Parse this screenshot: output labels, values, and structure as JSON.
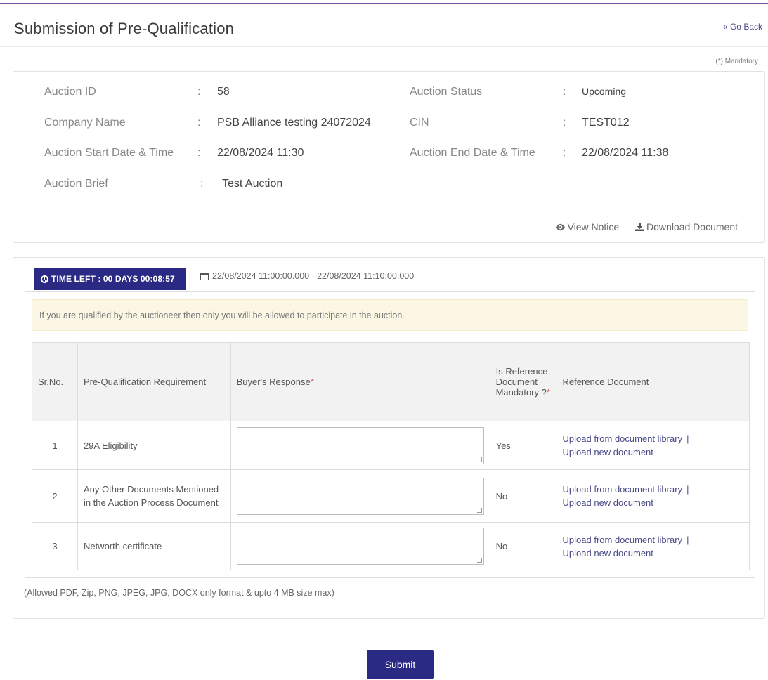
{
  "header": {
    "title": "Submission of Pre-Qualification",
    "go_back": "« Go Back",
    "mandatory_note": "(*) Mandatory"
  },
  "auction": {
    "fields": [
      {
        "label": "Auction ID",
        "value": "58"
      },
      {
        "label": "Auction Status",
        "value": "Upcoming"
      },
      {
        "label": "Company Name",
        "value": "PSB Alliance testing 24072024"
      },
      {
        "label": "CIN",
        "value": "TEST012"
      },
      {
        "label": "Auction Start Date & Time",
        "value": "22/08/2024 11:30"
      },
      {
        "label": "Auction End Date & Time",
        "value": "22/08/2024 11:38"
      },
      {
        "label": "Auction Brief",
        "value": "Test Auction"
      }
    ],
    "colon": ":",
    "view_notice": "View Notice",
    "separator": "|",
    "download_document": "Download Document"
  },
  "prequal": {
    "time_left": "TIME LEFT : 00 DAYS 00:08:57",
    "start_datetime": "22/08/2024 11:00:00.000",
    "end_datetime": "22/08/2024 11:10:00.000",
    "alert": "If you are qualified by the auctioneer then only you will be allowed to participate in the auction.",
    "columns": {
      "sr": "Sr.No.",
      "requirement": "Pre-Qualification Requirement",
      "response": "Buyer's Response",
      "ref_mandatory": "Is Reference Document Mandatory ?",
      "ref_document": "Reference Document",
      "required_star": "*"
    },
    "rows": [
      {
        "sr": "1",
        "requirement": "29A Eligibility",
        "response": "",
        "ref_mandatory": "Yes"
      },
      {
        "sr": "2",
        "requirement": "Any Other Documents Mentioned in the Auction Process Document",
        "response": "",
        "ref_mandatory": "No"
      },
      {
        "sr": "3",
        "requirement": "Networth certificate",
        "response": "",
        "ref_mandatory": "No"
      }
    ],
    "upload_library": "Upload from document library",
    "upload_pipe": "|",
    "upload_new": "Upload new document",
    "allowed_formats": "(Allowed PDF, Zip, PNG, JPEG, JPG, DOCX only format & upto 4 MB size max)"
  },
  "submit_label": "Submit",
  "colors": {
    "primary": "#2a2a84",
    "top_accent": "#7b4f9e",
    "alert_bg": "#fcf7e4",
    "required": "#d9534f"
  }
}
